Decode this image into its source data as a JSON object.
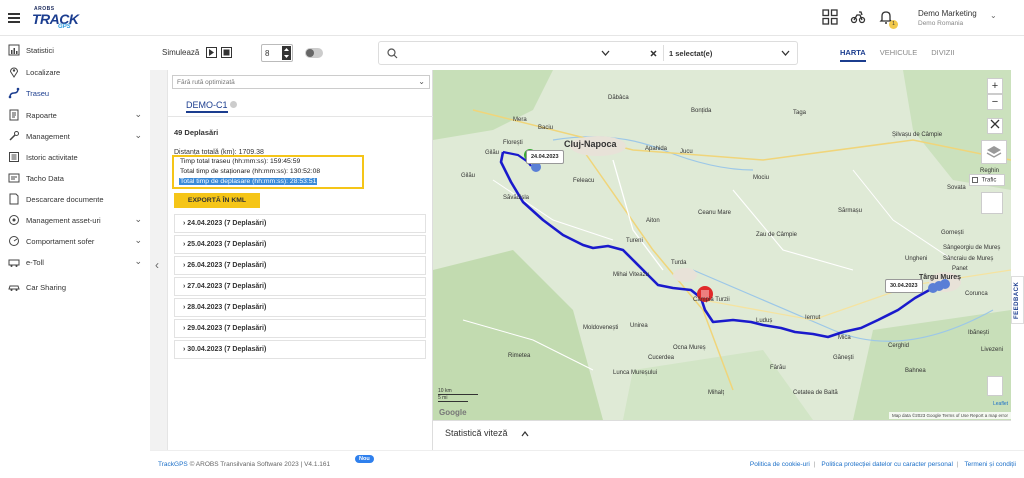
{
  "header": {
    "logo_small": "AROBS",
    "logo_big": "TRACK",
    "logo_gps": "GPS",
    "user_name": "Demo Marketing",
    "user_company": "Demo Romania",
    "notif_count": "1"
  },
  "sidebar": {
    "items": [
      {
        "label": "Statistici",
        "icon": "bar-chart-icon"
      },
      {
        "label": "Localizare",
        "icon": "pin-icon"
      },
      {
        "label": "Traseu",
        "icon": "route-icon"
      },
      {
        "label": "Rapoarte",
        "icon": "report-icon"
      },
      {
        "label": "Management",
        "icon": "wrench-icon"
      },
      {
        "label": "Istoric activitate",
        "icon": "history-icon"
      },
      {
        "label": "Tacho Data",
        "icon": "tacho-icon"
      },
      {
        "label": "Descarcare documente",
        "icon": "document-icon"
      },
      {
        "label": "Management asset-uri",
        "icon": "asset-icon"
      },
      {
        "label": "Comportament sofer",
        "icon": "driver-icon"
      },
      {
        "label": "e-Toll",
        "icon": "toll-icon"
      },
      {
        "label": "Car Sharing",
        "icon": "car-icon"
      }
    ]
  },
  "toolbar": {
    "simulate_label": "Simulează",
    "speed_value": "8",
    "selected_label": "1 selectat(e)"
  },
  "tabs": [
    "HARTA",
    "VEHICULE",
    "DIVIZII"
  ],
  "panel": {
    "route_placeholder": "Fără rută optimizată",
    "vehicle_tab": "DEMO-C1",
    "trips_count": "49 Deplasări",
    "distance": "Distanța totală (km): 1709.38",
    "total_time": "Timp total traseu (hh:mm:ss): 159:45:59",
    "stationary_time": "Total timp de staționare (hh:mm:ss): 130:52:08",
    "moving_time": "Total timp de deplasare (hh:mm:ss): 28:53:51",
    "kml_button": "EXPORTĂ ÎN KML",
    "days": [
      "24.04.2023 (7 Deplasări)",
      "25.04.2023 (7 Deplasări)",
      "26.04.2023 (7 Deplasări)",
      "27.04.2023 (7 Deplasări)",
      "28.04.2023 (7 Deplasări)",
      "29.04.2023 (7 Deplasări)",
      "30.04.2023 (7 Deplasări)"
    ]
  },
  "map": {
    "cities": [
      {
        "name": "Cluj-Napoca",
        "major": true
      },
      {
        "name": "Târgu Mureș",
        "major": true
      },
      {
        "name": "Turda",
        "major": false
      },
      {
        "name": "Gilău",
        "major": false
      },
      {
        "name": "Luduș",
        "major": false
      },
      {
        "name": "Iernut",
        "major": false
      },
      {
        "name": "Câmpia Turzii",
        "major": false
      },
      {
        "name": "Sovata",
        "major": false
      },
      {
        "name": "Reghin",
        "major": false
      },
      {
        "name": "Baciu",
        "major": false
      },
      {
        "name": "Florești",
        "major": false
      },
      {
        "name": "Feleacu",
        "major": false
      },
      {
        "name": "Săvădisla",
        "major": false
      },
      {
        "name": "Moldovenești",
        "major": false
      },
      {
        "name": "Mihai Viteazu",
        "major": false
      },
      {
        "name": "Ceanu Mare",
        "major": false
      },
      {
        "name": "Zau de Câmpie",
        "major": false
      },
      {
        "name": "Sărmașu",
        "major": false
      },
      {
        "name": "Bahnea",
        "major": false
      },
      {
        "name": "Cerghid",
        "major": false
      },
      {
        "name": "Ungheni",
        "major": false
      },
      {
        "name": "Corunca",
        "major": false
      },
      {
        "name": "Gornești",
        "major": false
      },
      {
        "name": "Sângeorgiu de Mureș",
        "major": false
      },
      {
        "name": "Ibănești",
        "major": false
      },
      {
        "name": "Panet",
        "major": false
      },
      {
        "name": "Livezeni",
        "major": false
      },
      {
        "name": "Sâncraiu de Mureș",
        "major": false
      },
      {
        "name": "Jucu",
        "major": false
      },
      {
        "name": "Apahida",
        "major": false
      },
      {
        "name": "Bonțida",
        "major": false
      },
      {
        "name": "Mociu",
        "major": false
      },
      {
        "name": "Tureni",
        "major": false
      },
      {
        "name": "Aiton",
        "major": false
      },
      {
        "name": "Mera",
        "major": false
      },
      {
        "name": "Dăbâca",
        "major": false
      },
      {
        "name": "Șilvașu de Câmpie",
        "major": false
      },
      {
        "name": "Taga",
        "major": false
      },
      {
        "name": "Mica",
        "major": false
      },
      {
        "name": "Ocna Mureș",
        "major": false
      },
      {
        "name": "Unirea",
        "major": false
      },
      {
        "name": "Rimetea",
        "major": false
      },
      {
        "name": "Lunca Mureșului",
        "major": false
      },
      {
        "name": "Cucerdea",
        "major": false
      },
      {
        "name": "Fârău",
        "major": false
      },
      {
        "name": "Găneşti",
        "major": false
      },
      {
        "name": "Cetatea de Baltă",
        "major": false
      },
      {
        "name": "Mihalț",
        "major": false
      },
      {
        "name": "Gilău",
        "major": false
      }
    ],
    "tooltip_start": "24.04.2023",
    "tooltip_end": "30.04.2023",
    "trafic_label": "Trafic",
    "scale_km": "10 km",
    "scale_mi": "5 mi",
    "attribution": "Map data ©2023 Google   Terms of Use   Report a map error",
    "leaflet": "Leaflet",
    "google": "Google"
  },
  "stats": {
    "speed_label": "Statistică viteză"
  },
  "footer": {
    "brand": "TrackGPS",
    "copyright": "© AROBS Transilvania Software 2023",
    "version": "V4.1.161",
    "new_badge": "Nou",
    "links": [
      "Politica de cookie-uri",
      "Politica protecției datelor cu caracter personal",
      "Termeni și condiții"
    ]
  },
  "feedback": "FEEDBACK"
}
